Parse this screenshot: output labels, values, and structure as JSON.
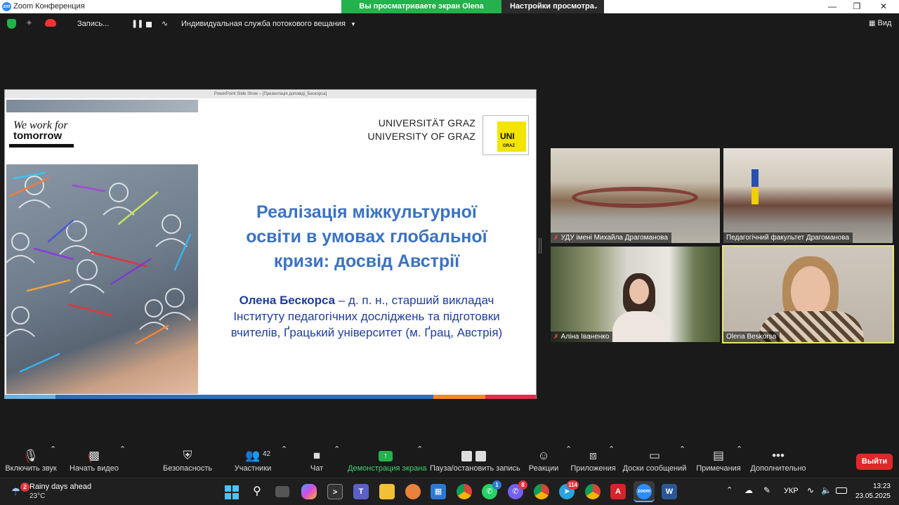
{
  "window": {
    "title": "Zoom Конференция",
    "logo_text": "zm",
    "share_banner": "Вы просматриваете экран Olena Beskorsa",
    "view_options": "Настройки просмотра"
  },
  "toolbar": {
    "recording_label": "Запись...",
    "stream_label": "Индивидуальная служба потокового вещания",
    "view_label": "Вид"
  },
  "slide": {
    "window_title": "PowerPoint Slide Show – [Презентація доповіді_Бескорса]",
    "tagline_top": "We work for",
    "tagline_bottom": "tomorrow",
    "uni_de": "UNIVERSITÄT GRAZ",
    "uni_en": "UNIVERSITY OF GRAZ",
    "logo_uni": "UNI",
    "logo_graz": "GRAZ",
    "title_lines": [
      "Реалізація міжкультурної",
      "освіти в умовах глобальної",
      "кризи: досвід Австрії"
    ],
    "author_name": "Олена Бескорса",
    "author_rest": " – д. п. н., старший викладач",
    "author_line2": "Інституту педагогічних досліджень та підготовки",
    "author_line3": "вчителів, Ґрацький університет (м. Ґрац, Австрія)"
  },
  "participants": [
    {
      "name": "УДУ імені Михайла Драгоманова",
      "muted": true
    },
    {
      "name": "Педагогічний факультет Драгоманова",
      "muted": false
    },
    {
      "name": "Аліна Іваненко",
      "muted": true
    },
    {
      "name": "Olena Beskorsa",
      "muted": false
    }
  ],
  "bottom_bar": {
    "audio": "Включить звук",
    "video": "Начать видео",
    "security": "Безопасность",
    "participants": "Участники",
    "participants_count": "42",
    "chat": "Чат",
    "share": "Демонстрация экрана",
    "pause_record": "Пауза/остановить запись",
    "reactions": "Реакции",
    "apps": "Приложения",
    "whiteboards": "Доски сообщений",
    "notes": "Примечания",
    "more": "Дополнительно",
    "leave": "Выйти"
  },
  "taskbar": {
    "weather_title": "Rainy days ahead",
    "weather_temp": "23°C",
    "weather_badge": "2",
    "badge_whatsapp": "1",
    "badge_viber": "8",
    "badge_telegram": "114",
    "language": "УКР",
    "time": "13:23",
    "date": "23.05.2025"
  },
  "colors": {
    "share_green": "#23b24b",
    "slide_title_blue": "#3b72c2",
    "author_blue": "#1f3d9c",
    "uni_yellow": "#f3e500",
    "leave_red": "#e02828",
    "active_speaker": "#e6e66e"
  }
}
